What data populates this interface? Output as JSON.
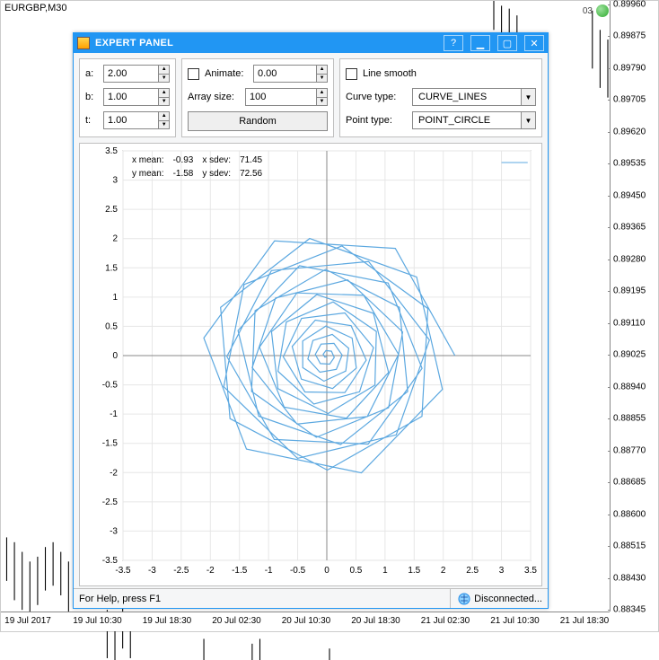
{
  "background": {
    "symbol": "EURGBP,M30",
    "badge_text": "03",
    "price_ticks": [
      0.8996,
      0.89875,
      0.8979,
      0.89705,
      0.8962,
      0.89535,
      0.8945,
      0.89365,
      0.8928,
      0.89195,
      0.8911,
      0.89025,
      0.8894,
      0.88855,
      0.8877,
      0.88685,
      0.886,
      0.88515,
      0.8843,
      0.88345
    ],
    "time_ticks": [
      "19 Jul 2017",
      "19 Jul 10:30",
      "19 Jul 18:30",
      "20 Jul 02:30",
      "20 Jul 10:30",
      "20 Jul 18:30",
      "21 Jul 02:30",
      "21 Jul 10:30",
      "21 Jul 18:30"
    ]
  },
  "panel": {
    "title": "EXPERT PANEL",
    "group1": {
      "a_label": "a:",
      "a_value": "2.00",
      "b_label": "b:",
      "b_value": "1.00",
      "t_label": "t:",
      "t_value": "1.00"
    },
    "group2": {
      "animate_label": "Animate:",
      "animate_value": "0.00",
      "arraysize_label": "Array size:",
      "arraysize_value": "100",
      "random_label": "Random"
    },
    "group3": {
      "linesmooth_label": "Line smooth",
      "curvetype_label": "Curve type:",
      "curvetype_value": "CURVE_LINES",
      "pointtype_label": "Point type:",
      "pointtype_value": "POINT_CIRCLE"
    },
    "status": {
      "help": "For Help, press F1",
      "conn": "Disconnected..."
    }
  },
  "chart_data": {
    "type": "line",
    "title": "",
    "xlabel": "",
    "ylabel": "",
    "xlim": [
      -3.5,
      3.5
    ],
    "ylim": [
      -3.5,
      3.5
    ],
    "x_ticks": [
      -3.5,
      -3,
      -2.5,
      -2,
      -1.5,
      -1,
      -0.5,
      0,
      0.5,
      1,
      1.5,
      2,
      2.5,
      3,
      3.5
    ],
    "y_ticks": [
      -3.5,
      -3,
      -2.5,
      -2,
      -1.5,
      -1,
      -0.5,
      0,
      0.5,
      1,
      1.5,
      2,
      2.5,
      3,
      3.5
    ],
    "stats": {
      "x_mean": -0.93,
      "x_sdev": 71.45,
      "y_mean": -1.58,
      "y_sdev": 72.56
    },
    "series": [
      {
        "name": "spiral",
        "params": {
          "a": 2.0,
          "b": 1.0,
          "t": 1.0,
          "n": 100
        },
        "generator": "spiral_polygon",
        "note": "points are r=2.2*(1-i/100), theta=i*1.0 rad; x=r*cos, y=r*sin"
      }
    ],
    "colors": {
      "line": "#5ca8e0",
      "grid": "#e6e6e6",
      "axis": "#888888"
    }
  }
}
